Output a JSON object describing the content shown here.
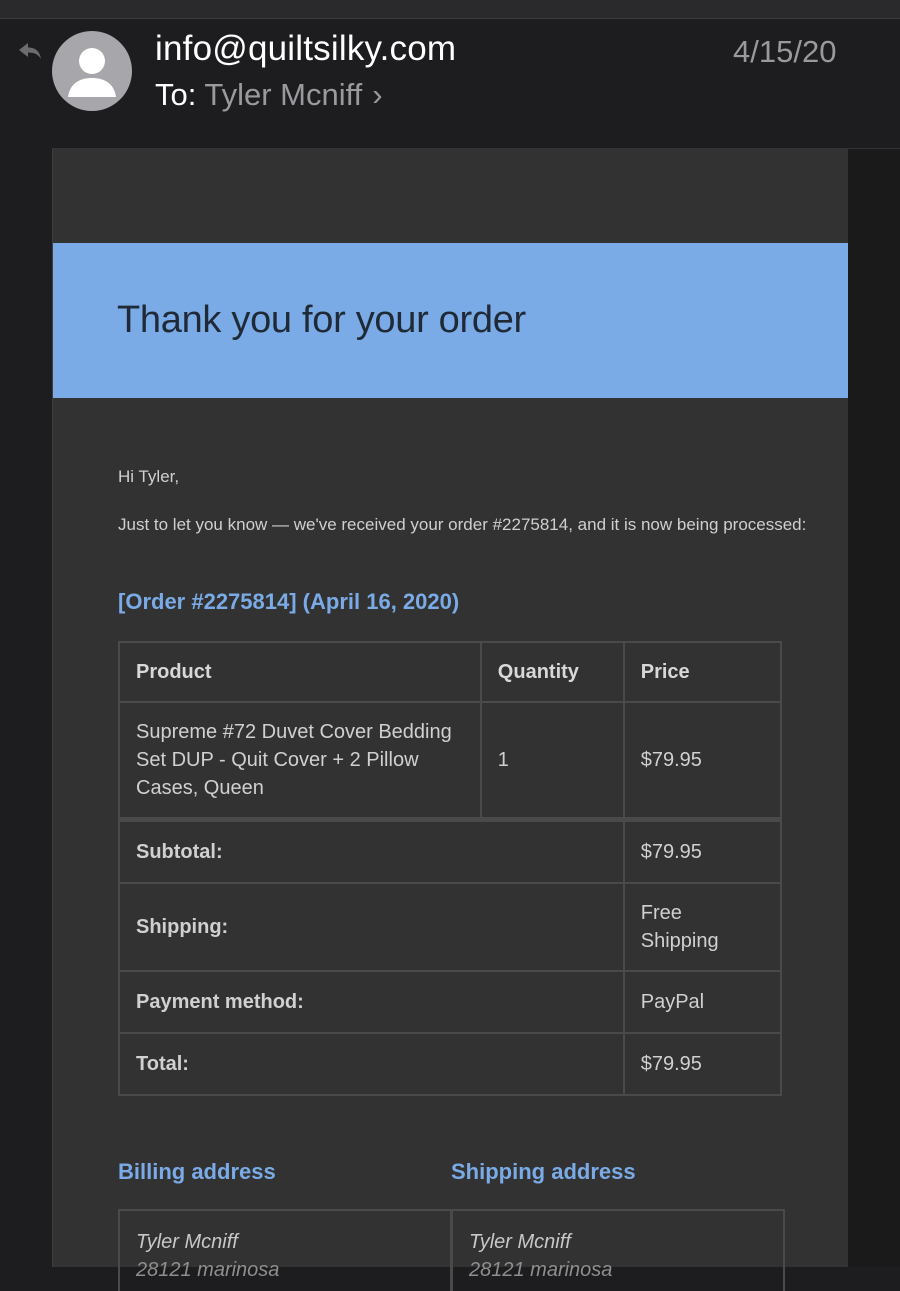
{
  "header": {
    "sender": "info@quiltsilky.com",
    "to_label": "To:",
    "to_name": "Tyler Mcniff",
    "chevron": "›",
    "date": "4/15/20",
    "reply_icon": "reply-arrow-icon",
    "avatar_icon": "person-silhouette-icon"
  },
  "email": {
    "banner_title": "Thank you for your order",
    "greeting": "Hi Tyler,",
    "intro": "Just to let you know — we've received your order #2275814, and it is now being processed:",
    "order_heading": "[Order #2275814] (April 16, 2020)",
    "table": {
      "headers": [
        "Product",
        "Quantity",
        "Price"
      ],
      "item": {
        "product": "Supreme #72 Duvet Cover Bedding Set DUP - Quit Cover + 2 Pillow Cases, Queen",
        "quantity": "1",
        "price": "$79.95"
      },
      "summary": [
        {
          "label": "Subtotal:",
          "value": "$79.95"
        },
        {
          "label": "Shipping:",
          "value": "Free Shipping"
        },
        {
          "label": "Payment method:",
          "value": "PayPal"
        },
        {
          "label": "Total:",
          "value": "$79.95"
        }
      ]
    },
    "billing": {
      "heading": "Billing address",
      "name": "Tyler Mcniff",
      "line2": "28121 marinosa"
    },
    "shipping": {
      "heading": "Shipping address",
      "name": "Tyler Mcniff",
      "line2": "28121 marinosa"
    }
  },
  "colors": {
    "accent": "#7aabe6",
    "background": "#1d1d1f",
    "email_body": "#323232"
  }
}
